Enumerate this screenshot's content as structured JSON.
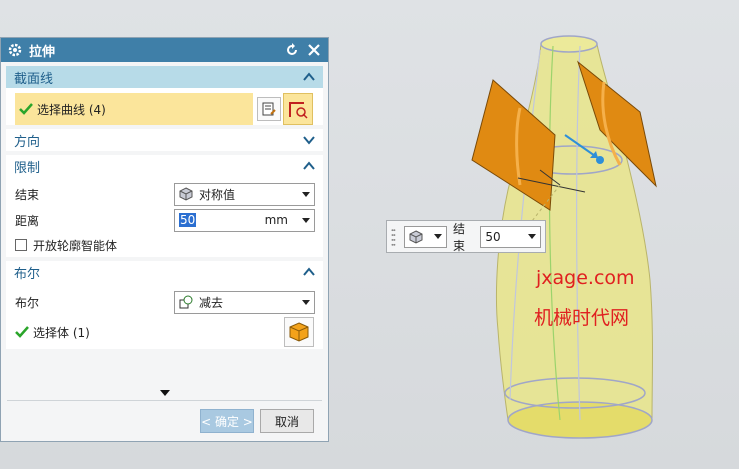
{
  "dialog": {
    "title": "拉伸",
    "sections": {
      "section_curve": {
        "label": "截面线",
        "select_curve": "选择曲线 (4)"
      },
      "direction": {
        "label": "方向"
      },
      "limits": {
        "label": "限制",
        "end_label": "结束",
        "end_value": "对称值",
        "distance_label": "距离",
        "distance_value": "50",
        "distance_unit": "mm",
        "open_profile_label": "开放轮廓智能体"
      },
      "boolean": {
        "label": "布尔",
        "boolean_label": "布尔",
        "boolean_value": "减去",
        "select_body": "选择体 (1)"
      }
    },
    "ok_label": "< 确定 >",
    "cancel_label": "取消"
  },
  "handle": {
    "end_label": "结束",
    "value": "50"
  },
  "watermark": {
    "line1": "jxage.com",
    "line2": "机械时代网"
  },
  "colors": {
    "title_bar": "#3f7fa8",
    "section_header_active": "#b7dbe8",
    "selection_yellow": "#fbe59b",
    "body_fill": "#e9e58a",
    "tool_orange": "#e08a12",
    "watermark": "#e02020"
  }
}
